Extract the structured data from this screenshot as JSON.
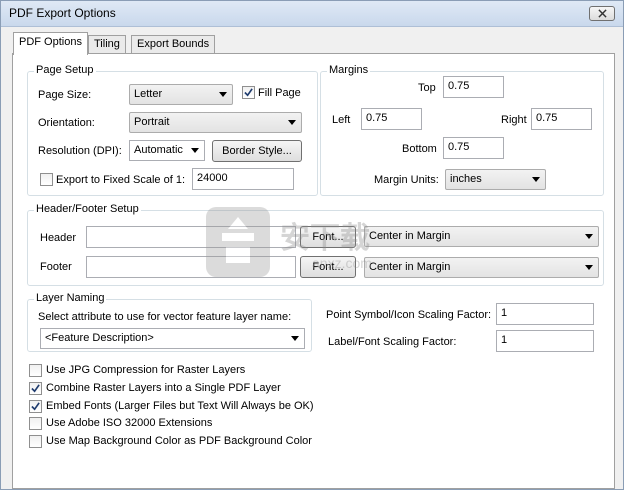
{
  "window": {
    "title": "PDF Export Options",
    "close_icon": "close-icon"
  },
  "tabs": [
    {
      "label": "PDF Options",
      "active": true
    },
    {
      "label": "Tiling",
      "active": false
    },
    {
      "label": "Export Bounds",
      "active": false
    }
  ],
  "page_setup": {
    "title": "Page Setup",
    "page_size_label": "Page Size:",
    "page_size_value": "Letter",
    "fill_page_label": "Fill Page",
    "fill_page_checked": true,
    "orientation_label": "Orientation:",
    "orientation_value": "Portrait",
    "resolution_label": "Resolution (DPI):",
    "resolution_value": "Automatic",
    "border_style_label": "Border Style...",
    "fixed_scale_label": "Export to Fixed Scale of 1:",
    "fixed_scale_checked": false,
    "fixed_scale_value": "24000"
  },
  "margins": {
    "title": "Margins",
    "top_label": "Top",
    "top_value": "0.75",
    "left_label": "Left",
    "left_value": "0.75",
    "right_label": "Right",
    "right_value": "0.75",
    "bottom_label": "Bottom",
    "bottom_value": "0.75",
    "units_label": "Margin Units:",
    "units_value": "inches"
  },
  "header_footer": {
    "title": "Header/Footer Setup",
    "header_label": "Header",
    "header_value": "",
    "header_font_label": "Font...",
    "header_align_value": "Center in Margin",
    "footer_label": "Footer",
    "footer_value": "",
    "footer_font_label": "Font...",
    "footer_align_value": "Center in Margin"
  },
  "layer_naming": {
    "title": "Layer Naming",
    "prompt": "Select attribute to use for vector feature layer name:",
    "value": "<Feature Description>"
  },
  "scaling": {
    "point_label": "Point Symbol/Icon Scaling Factor:",
    "point_value": "1",
    "label_label": "Label/Font Scaling Factor:",
    "label_value": "1"
  },
  "options": [
    {
      "label": "Use JPG Compression for Raster Layers",
      "checked": false
    },
    {
      "label": "Combine Raster Layers into a Single PDF Layer",
      "checked": true
    },
    {
      "label": "Embed Fonts (Larger Files but Text Will Always be OK)",
      "checked": true
    },
    {
      "label": "Use Adobe ISO 32000 Extensions",
      "checked": false
    },
    {
      "label": "Use Map Background Color as PDF Background Color",
      "checked": false
    }
  ],
  "watermark": {
    "text": "安下载",
    "subtext": "anxz.com"
  }
}
